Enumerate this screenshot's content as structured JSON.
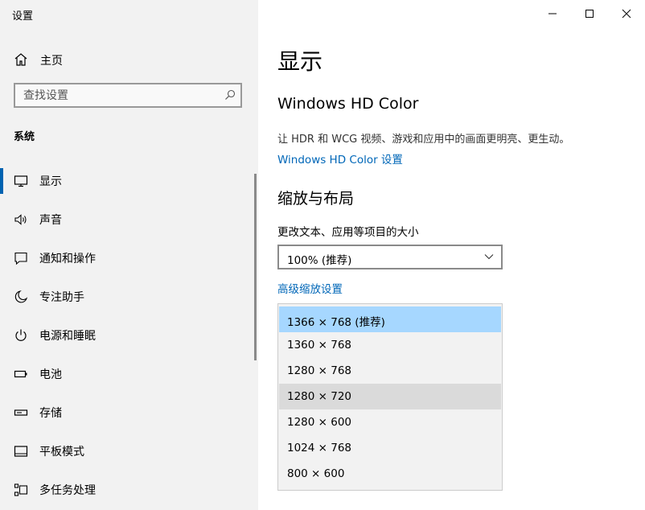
{
  "window": {
    "title": "设置"
  },
  "sidebar": {
    "home_label": "主页",
    "search_placeholder": "查找设置",
    "section_title": "系统",
    "items": [
      {
        "label": "显示",
        "icon": "monitor-icon",
        "active": true
      },
      {
        "label": "声音",
        "icon": "speaker-icon"
      },
      {
        "label": "通知和操作",
        "icon": "notification-icon"
      },
      {
        "label": "专注助手",
        "icon": "moon-icon"
      },
      {
        "label": "电源和睡眠",
        "icon": "power-icon"
      },
      {
        "label": "电池",
        "icon": "battery-icon"
      },
      {
        "label": "存储",
        "icon": "storage-icon"
      },
      {
        "label": "平板模式",
        "icon": "tablet-icon"
      },
      {
        "label": "多任务处理",
        "icon": "multitask-icon"
      }
    ]
  },
  "main": {
    "page_title": "显示",
    "hd": {
      "title": "Windows HD Color",
      "description": "让 HDR 和 WCG 视频、游戏和应用中的画面更明亮、更生动。",
      "link": "Windows HD Color 设置"
    },
    "scale": {
      "title": "缩放与布局",
      "label": "更改文本、应用等项目的大小",
      "selected": "100% (推荐)",
      "advanced_link": "高级缩放设置"
    },
    "resolution_options": [
      {
        "label": "1366 × 768 (推荐)",
        "state": "selected"
      },
      {
        "label": "1360 × 768",
        "state": ""
      },
      {
        "label": "1280 × 768",
        "state": ""
      },
      {
        "label": "1280 × 720",
        "state": "hover"
      },
      {
        "label": "1280 × 600",
        "state": ""
      },
      {
        "label": "1024 × 768",
        "state": ""
      },
      {
        "label": "800 × 600",
        "state": ""
      }
    ]
  },
  "colors": {
    "accent": "#0063b1",
    "link": "#0067b8",
    "selected_option": "#a6d7ff",
    "sidebar_bg": "#f2f2f2"
  }
}
